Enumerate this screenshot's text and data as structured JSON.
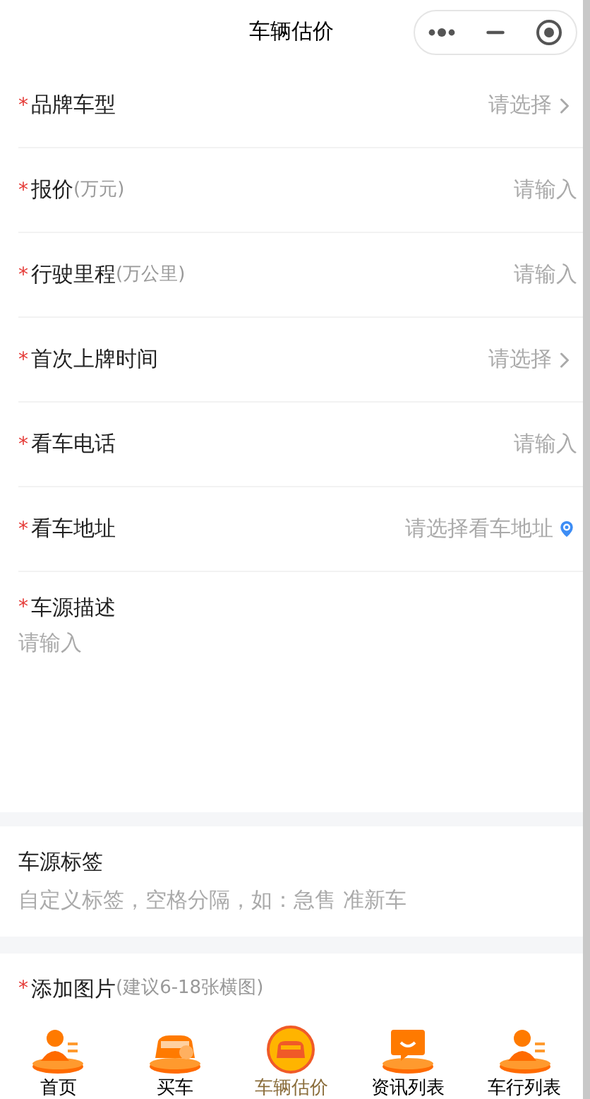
{
  "header": {
    "title": "车辆估价"
  },
  "fields": [
    {
      "mark": "*",
      "label": "品牌车型",
      "kind": "select",
      "placeholder": "请选择"
    },
    {
      "mark": "*",
      "label": "报价",
      "unit": "(万元)",
      "kind": "input",
      "placeholder": "请输入"
    },
    {
      "mark": "*",
      "label": "行驶里程",
      "unit": "(万公里)",
      "kind": "input",
      "placeholder": "请输入"
    },
    {
      "mark": "*",
      "label": "首次上牌时间",
      "kind": "select",
      "placeholder": "请选择"
    },
    {
      "mark": "*",
      "label": "看车电话",
      "kind": "input",
      "placeholder": "请输入"
    },
    {
      "mark": "*",
      "label": "看车地址",
      "kind": "location",
      "placeholder": "请选择看车地址"
    }
  ],
  "description": {
    "mark": "*",
    "label": "车源描述",
    "placeholder": "请输入"
  },
  "tags": {
    "label": "车源标签",
    "placeholder": "自定义标签，空格分隔，如：急售 准新车"
  },
  "photos": {
    "mark": "*",
    "label": "添加图片",
    "hint": "(建议6-18张横图)"
  },
  "tab_bar": [
    {
      "label": "首页",
      "kind": "person",
      "selected": false
    },
    {
      "label": "买车",
      "kind": "car",
      "selected": false
    },
    {
      "label": "车辆估价",
      "kind": "car-circle",
      "selected": true
    },
    {
      "label": "资讯列表",
      "kind": "chat",
      "selected": false
    },
    {
      "label": "车行列表",
      "kind": "person",
      "selected": false
    }
  ]
}
